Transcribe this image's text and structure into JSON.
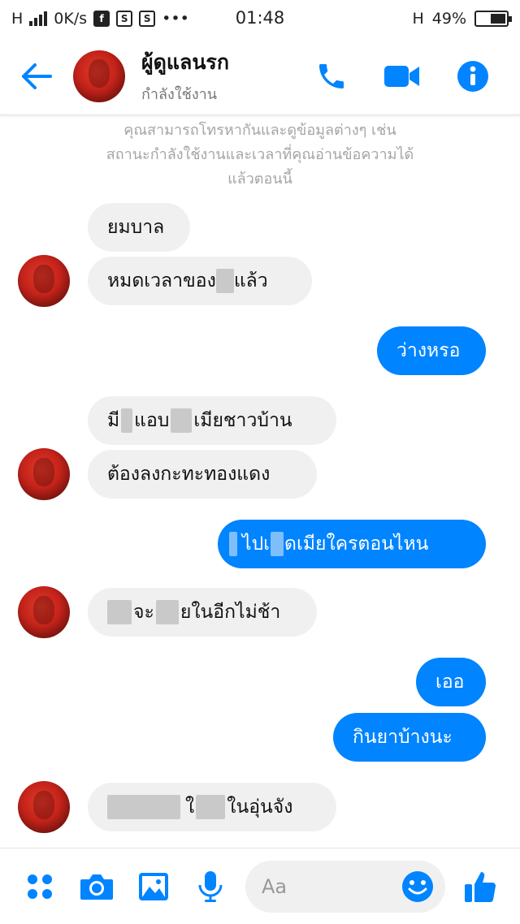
{
  "status_bar": {
    "network": "H",
    "speed": "0K/s",
    "dots": "•••",
    "time": "01:48",
    "network_right": "H",
    "battery": "49%"
  },
  "header": {
    "name": "ผู้ดูแลนรก",
    "status": "กำลังใช้งาน",
    "icons": [
      "back-arrow-icon",
      "phone-icon",
      "video-icon",
      "info-icon"
    ],
    "accent": "#0084ff"
  },
  "notice": {
    "line1": "คุณสามารถโทรหากันและดูข้อมูลต่างๆ เช่น",
    "line2": "สถานะกำลังใช้งานและเวลาที่คุณอ่านข้อความได้",
    "line3": "แล้วตอนนี้"
  },
  "messages": {
    "m1": "ยมบาล",
    "m2a": "หมดเวลาของ",
    "m2b": "แล้ว",
    "m3": "ว่างหรอ",
    "m4a": "มี",
    "m4b": "แอบ",
    "m4c": "เมียชาวบ้าน",
    "m5": "ต้องลงกะทะทองแดง",
    "m6a": "ไปเ",
    "m6b": "ดเมียใครตอนไหน",
    "m7a": "จะ",
    "m7b": "ยในอีกไม่ช้า",
    "m8": "เออ",
    "m9": "กินยาบ้างนะ",
    "m10a": "ใ",
    "m10b": "ในอุ่นจัง"
  },
  "composer": {
    "placeholder": "Aa",
    "icons": [
      "menu-dots-icon",
      "camera-icon",
      "image-icon",
      "microphone-icon",
      "emoji-icon",
      "thumbs-up-icon"
    ]
  },
  "colors": {
    "outgoing": "#0084ff",
    "incoming": "#f1f0f0",
    "notice_text": "#a5a5a5"
  }
}
